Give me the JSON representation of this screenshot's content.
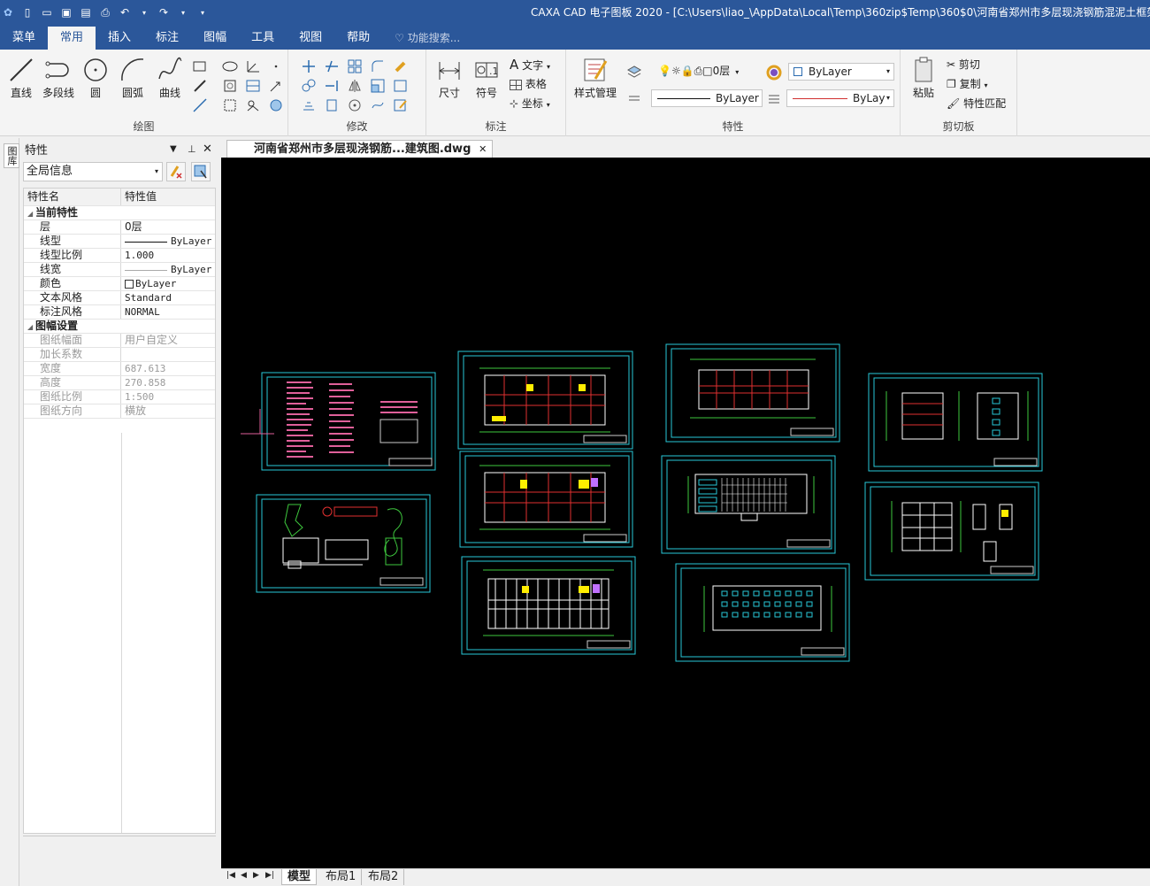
{
  "titlebar": {
    "title": "CAXA CAD 电子图板 2020 - [C:\\Users\\liao_\\AppData\\Local\\Temp\\360zip$Temp\\360$0\\河南省郑州市多层现浇钢筋混泥土框架结构"
  },
  "menu": {
    "tabs": [
      "菜单",
      "常用",
      "插入",
      "标注",
      "图幅",
      "工具",
      "视图",
      "帮助"
    ],
    "search": "功能搜索..."
  },
  "ribbon": {
    "draw": {
      "label": "绘图",
      "buttons": [
        "直线",
        "多段线",
        "圆",
        "圆弧",
        "曲线"
      ]
    },
    "modify": {
      "label": "修改"
    },
    "annot": {
      "label": "标注",
      "dim": "尺寸",
      "symbol": "符号",
      "text": "文字",
      "table": "表格",
      "coord": "坐标"
    },
    "props": {
      "label": "特性",
      "style_mgr": "样式管理",
      "layer": "0层",
      "color": "ByLayer",
      "linetype": "ByLayer",
      "lineweight": "ByLay"
    },
    "clipboard": {
      "label": "剪切板",
      "paste": "粘贴",
      "cut": "剪切",
      "copy": "复制",
      "match": "特性匹配"
    }
  },
  "lefttab": {
    "label": "图库"
  },
  "panel": {
    "title": "特性",
    "combo": "全局信息",
    "col_name": "特性名",
    "col_value": "特性值",
    "cat1": "当前特性",
    "rows1": [
      {
        "n": "层",
        "v": "0层"
      },
      {
        "n": "线型",
        "v": "ByLayer"
      },
      {
        "n": "线型比例",
        "v": "1.000"
      },
      {
        "n": "线宽",
        "v": "ByLayer"
      },
      {
        "n": "颜色",
        "v": "ByLayer"
      },
      {
        "n": "文本风格",
        "v": "Standard"
      },
      {
        "n": "标注风格",
        "v": "NORMAL"
      }
    ],
    "cat2": "图幅设置",
    "rows2": [
      {
        "n": "图纸幅面",
        "v": "用户自定义"
      },
      {
        "n": "加长系数",
        "v": ""
      },
      {
        "n": "宽度",
        "v": "687.613"
      },
      {
        "n": "高度",
        "v": "270.858"
      },
      {
        "n": "图纸比例",
        "v": "1:500"
      },
      {
        "n": "图纸方向",
        "v": "横放"
      }
    ]
  },
  "document": {
    "tab": "河南省郑州市多层现浇钢筋...建筑图.dwg"
  },
  "layouts": {
    "model": "模型",
    "layout1": "布局1",
    "layout2": "布局2"
  },
  "colors": {
    "accent": "#2b579a",
    "canvas": "#000000",
    "frame": "#28c8d8"
  }
}
